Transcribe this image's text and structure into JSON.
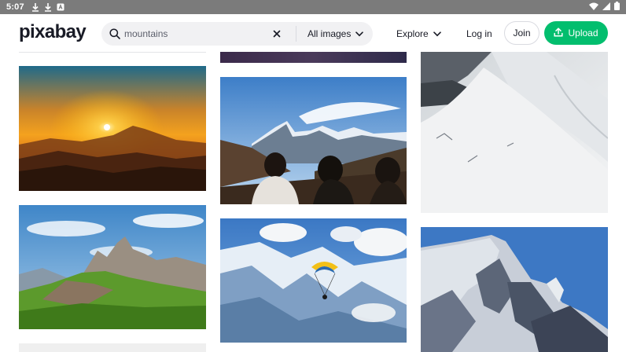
{
  "status_bar": {
    "time": "5:07",
    "icons": [
      "download-icon",
      "download-icon",
      "app-notification-icon"
    ],
    "right_icons": [
      "wifi-icon",
      "signal-icon",
      "battery-icon"
    ]
  },
  "header": {
    "logo_text": "pixabay",
    "search": {
      "value": "mountains",
      "placeholder": "Search"
    },
    "filter_label": "All images",
    "explore_label": "Explore",
    "login_label": "Log in",
    "join_label": "Join",
    "upload_label": "Upload",
    "brand_color": "#02be6e"
  },
  "gallery": {
    "images": [
      {
        "id": "sunset-mountain",
        "description_icon": "image"
      },
      {
        "id": "dusk-strip",
        "description_icon": "image"
      },
      {
        "id": "snow-slope",
        "description_icon": "image"
      },
      {
        "id": "hikers-peaks",
        "description_icon": "image"
      },
      {
        "id": "green-dolomites",
        "description_icon": "image"
      },
      {
        "id": "paraglider-alps",
        "description_icon": "image"
      },
      {
        "id": "snow-peak-blue-sky",
        "description_icon": "image"
      },
      {
        "id": "placeholder-tile",
        "description_icon": "image"
      }
    ]
  }
}
